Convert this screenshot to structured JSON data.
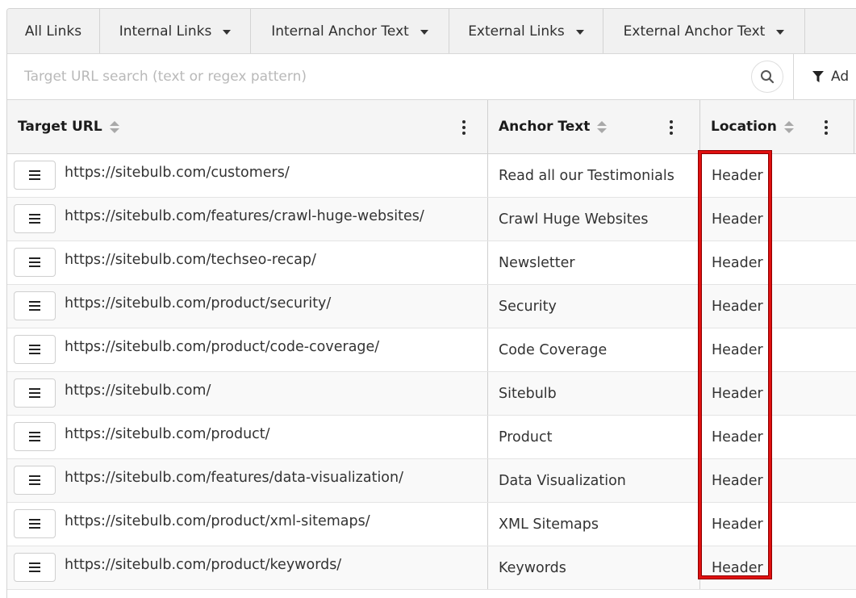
{
  "tabs": [
    {
      "label": "All Links",
      "dropdown": false
    },
    {
      "label": "Internal Links",
      "dropdown": true
    },
    {
      "label": "Internal Anchor Text",
      "dropdown": true
    },
    {
      "label": "External Links",
      "dropdown": true
    },
    {
      "label": "External Anchor Text",
      "dropdown": true
    }
  ],
  "search": {
    "placeholder": "Target URL search (text or regex pattern)",
    "value": "",
    "advanced_filter_label": "Ad"
  },
  "table": {
    "columns": [
      {
        "label": "Target URL"
      },
      {
        "label": "Anchor Text"
      },
      {
        "label": "Location"
      }
    ],
    "rows": [
      {
        "url": "https://sitebulb.com/customers/",
        "anchor": "Read all our Testimonials",
        "location": "Header"
      },
      {
        "url": "https://sitebulb.com/features/crawl-huge-websites/",
        "anchor": "Crawl Huge Websites",
        "location": "Header"
      },
      {
        "url": "https://sitebulb.com/techseo-recap/",
        "anchor": "Newsletter",
        "location": "Header"
      },
      {
        "url": "https://sitebulb.com/product/security/",
        "anchor": "Security",
        "location": "Header"
      },
      {
        "url": "https://sitebulb.com/product/code-coverage/",
        "anchor": "Code Coverage",
        "location": "Header"
      },
      {
        "url": "https://sitebulb.com/",
        "anchor": "Sitebulb",
        "location": "Header"
      },
      {
        "url": "https://sitebulb.com/product/",
        "anchor": "Product",
        "location": "Header"
      },
      {
        "url": "https://sitebulb.com/features/data-visualization/",
        "anchor": "Data Visualization",
        "location": "Header"
      },
      {
        "url": "https://sitebulb.com/product/xml-sitemaps/",
        "anchor": "XML Sitemaps",
        "location": "Header"
      },
      {
        "url": "https://sitebulb.com/product/keywords/",
        "anchor": "Keywords",
        "location": "Header"
      }
    ]
  },
  "colors": {
    "highlight": "#e01010",
    "tab_background": "#f1f1f1",
    "header_background": "#f5f5f5"
  },
  "icons": {
    "search": "search-icon",
    "filter": "filter-icon",
    "row_menu": "hamburger-menu-icon",
    "column_menu": "kebab-menu-icon",
    "sort": "sort-icon",
    "dropdown": "chevron-down-icon"
  }
}
